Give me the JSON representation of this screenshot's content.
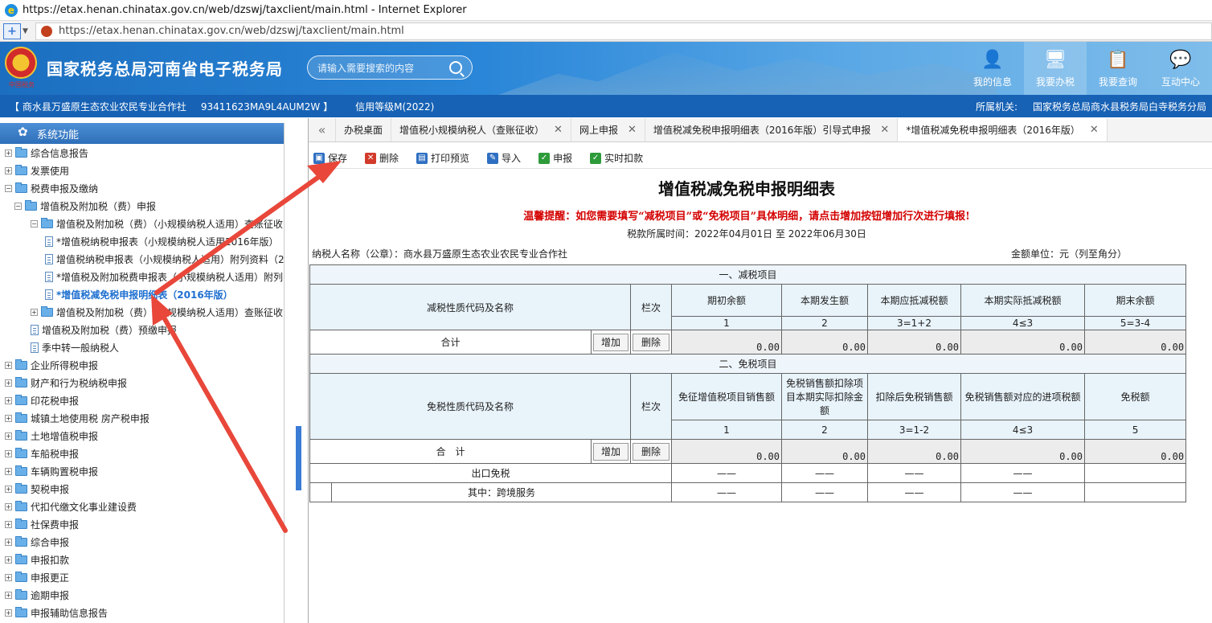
{
  "window": {
    "title": "https://etax.henan.chinatax.gov.cn/web/dzswj/taxclient/main.html - Internet Explorer"
  },
  "address": {
    "url": "https://etax.henan.chinatax.gov.cn/web/dzswj/taxclient/main.html"
  },
  "header": {
    "brand": "国家税务总局河南省电子税务局",
    "search_placeholder": "请输入需要搜索的内容",
    "nav": [
      {
        "label": "我的信息",
        "icon": "user-icon"
      },
      {
        "label": "我要办税",
        "icon": "monitor-icon"
      },
      {
        "label": "我要查询",
        "icon": "document-search-icon"
      },
      {
        "label": "互动中心",
        "icon": "chat-icon"
      }
    ]
  },
  "infobar": {
    "company": "【 商水县万盛原生态农业农民专业合作社",
    "tax_id": "93411623MA9L4AUM2W 】",
    "credit": "信用等级M(2022)",
    "authority_label": "所属机关:",
    "authority": "国家税务总局商水县税务局白寺税务分局"
  },
  "sidebar": {
    "title": "系统功能",
    "items": [
      {
        "label": "综合信息报告",
        "level": 0,
        "type": "folder"
      },
      {
        "label": "发票使用",
        "level": 0,
        "type": "folder"
      },
      {
        "label": "税费申报及缴纳",
        "level": 0,
        "type": "folder"
      },
      {
        "label": "增值税及附加税（费）申报",
        "level": 1,
        "type": "folder"
      },
      {
        "label": "增值税及附加税（费）（小规模纳税人适用）查账征收",
        "level": 2,
        "type": "folder"
      },
      {
        "label": "*增值税纳税申报表（小规模纳税人适用2016年版）",
        "level": 3,
        "type": "doc"
      },
      {
        "label": "增值税纳税申报表（小规模纳税人适用）附列资料（2",
        "level": 3,
        "type": "doc"
      },
      {
        "label": "*增值税及附加税费申报表（小规模纳税人适用）附列",
        "level": 3,
        "type": "doc"
      },
      {
        "label": "*增值税减免税申报明细表（2016年版）",
        "level": 3,
        "type": "doc"
      },
      {
        "label": "增值税及附加税（费）（小规模纳税人适用）查账征收",
        "level": 2,
        "type": "folder"
      },
      {
        "label": "增值税及附加税（费）预缴申报",
        "level": 2,
        "type": "doc"
      },
      {
        "label": "季中转一般纳税人",
        "level": 2,
        "type": "doc"
      },
      {
        "label": "企业所得税申报",
        "level": 0,
        "type": "folder"
      },
      {
        "label": "财产和行为税纳税申报",
        "level": 0,
        "type": "folder"
      },
      {
        "label": "印花税申报",
        "level": 0,
        "type": "folder"
      },
      {
        "label": "城镇土地使用税 房产税申报",
        "level": 0,
        "type": "folder"
      },
      {
        "label": "土地增值税申报",
        "level": 0,
        "type": "folder"
      },
      {
        "label": "车船税申报",
        "level": 0,
        "type": "folder"
      },
      {
        "label": "车辆购置税申报",
        "level": 0,
        "type": "folder"
      },
      {
        "label": "契税申报",
        "level": 0,
        "type": "folder"
      },
      {
        "label": "代扣代缴文化事业建设费",
        "level": 0,
        "type": "folder"
      },
      {
        "label": "社保费申报",
        "level": 0,
        "type": "folder"
      },
      {
        "label": "综合申报",
        "level": 0,
        "type": "folder"
      },
      {
        "label": "申报扣款",
        "level": 0,
        "type": "folder"
      },
      {
        "label": "申报更正",
        "level": 0,
        "type": "folder"
      },
      {
        "label": "逾期申报",
        "level": 0,
        "type": "folder"
      },
      {
        "label": "申报辅助信息报告",
        "level": 0,
        "type": "folder"
      }
    ]
  },
  "tabs": [
    {
      "label": "办税桌面",
      "closable": false
    },
    {
      "label": "增值税小规模纳税人（查账征收）",
      "closable": true
    },
    {
      "label": "网上申报",
      "closable": true
    },
    {
      "label": "增值税减免税申报明细表（2016年版）引导式申报",
      "closable": true
    },
    {
      "label": "*增值税减免税申报明细表（2016年版）",
      "closable": true
    }
  ],
  "toolbar": [
    {
      "label": "保存",
      "icon": "save-icon",
      "color": "#2f6fc2"
    },
    {
      "label": "删除",
      "icon": "delete-icon",
      "color": "#d23a2a"
    },
    {
      "label": "打印预览",
      "icon": "print-icon",
      "color": "#2f6fc2"
    },
    {
      "label": "导入",
      "icon": "import-icon",
      "color": "#2f6fc2"
    },
    {
      "label": "申报",
      "icon": "check-icon",
      "color": "#2e9b3a"
    },
    {
      "label": "实时扣款",
      "icon": "check-icon",
      "color": "#2e9b3a"
    }
  ],
  "form": {
    "title": "增值税减免税申报明细表",
    "notice": "温馨提醒：如您需要填写“减税项目”或“免税项目”具体明细，请点击增加按钮增加行次进行填报!",
    "period": "税款所属时间：2022年04月01日 至 2022年06月30日",
    "taxpayer": "纳税人名称（公章）：商水县万盛原生态农业农民专业合作社",
    "unit": "金额单位：元（列至角分）",
    "sec1": {
      "title": "一、减税项目",
      "name_col": "减税性质代码及名称",
      "row_col": "栏次",
      "cols": [
        "期初余额",
        "本期发生额",
        "本期应抵减税额",
        "本期实际抵减税额",
        "期末余额"
      ],
      "col_nums": [
        "1",
        "2",
        "3=1+2",
        "4≤3",
        "5=3-4"
      ],
      "total_label": "合计",
      "add": "增加",
      "del": "删除",
      "values": [
        "0.00",
        "0.00",
        "0.00",
        "0.00",
        "0.00"
      ]
    },
    "sec2": {
      "title": "二、免税项目",
      "name_col": "免税性质代码及名称",
      "row_col": "栏次",
      "cols": [
        "免征增值税项目销售额",
        "免税销售额扣除项目本期实际扣除金额",
        "扣除后免税销售额",
        "免税销售额对应的进项税额",
        "免税额"
      ],
      "col_nums": [
        "1",
        "2",
        "3=1-2",
        "4≤3",
        "5"
      ],
      "total_label": "合　计",
      "add": "增加",
      "del": "删除",
      "values": [
        "0.00",
        "0.00",
        "0.00",
        "0.00",
        "0.00"
      ],
      "export_label": "出口免税",
      "export_vals": [
        "——",
        "——",
        "——",
        "——"
      ],
      "cross_label": "其中：跨境服务",
      "cross_vals": [
        "——",
        "——",
        "——",
        "——"
      ]
    }
  }
}
